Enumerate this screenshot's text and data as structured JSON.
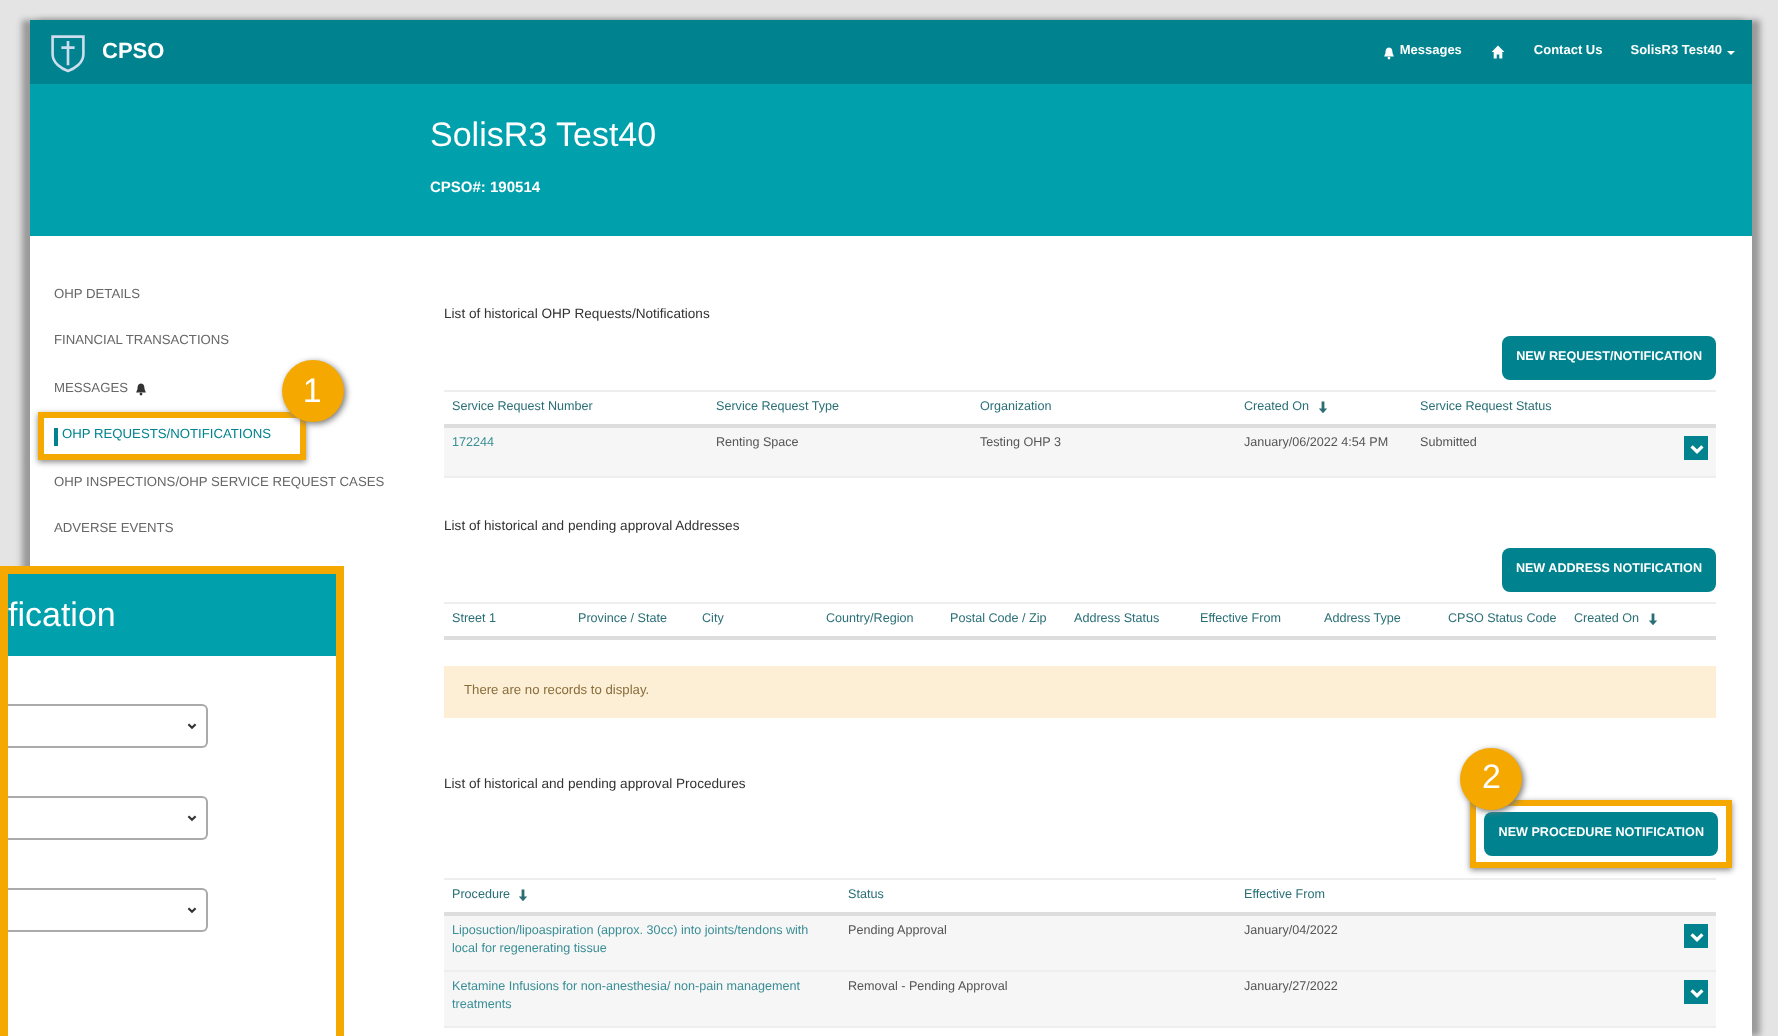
{
  "navbar": {
    "brand": "CPSO",
    "links": [
      {
        "kind": "messages",
        "label": "Messages"
      },
      {
        "kind": "home"
      },
      {
        "kind": "text",
        "label": "Contact Us"
      },
      {
        "kind": "user",
        "label": "SolisR3 Test40"
      }
    ]
  },
  "header": {
    "name": "SolisR3 Test40",
    "cpso_number": "CPSO#: 190514"
  },
  "sidebar": {
    "items": [
      {
        "label": "OHP DETAILS",
        "selected": false,
        "bell": false
      },
      {
        "label": "FINANCIAL TRANSACTIONS",
        "selected": false,
        "bell": false
      },
      {
        "label": "MESSAGES",
        "selected": false,
        "bell": true
      },
      {
        "label": "OHP REQUESTS/NOTIFICATIONS",
        "selected": true,
        "bell": false,
        "callout": "1"
      },
      {
        "label": "OHP INSPECTIONS/OHP SERVICE REQUEST CASES",
        "selected": false,
        "bell": false
      },
      {
        "label": "ADVERSE EVENTS",
        "selected": false,
        "bell": false
      }
    ]
  },
  "sections": [
    {
      "title": "List of historical OHP Requests/Notifications",
      "button": {
        "label": "NEW REQUEST/NOTIFICATION"
      },
      "columns": [
        {
          "label": "Service Request Number",
          "sorted": false
        },
        {
          "label": "Service Request Type",
          "sorted": false
        },
        {
          "label": "Organization",
          "sorted": false
        },
        {
          "label": "Created On",
          "sorted": true
        },
        {
          "label": "Service Request Status",
          "sorted": false
        }
      ],
      "rows": [
        {
          "cells": [
            "172244",
            "Renting Space",
            "Testing OHP 3",
            "January/06/2022 4:54 PM",
            "Submitted"
          ]
        }
      ]
    },
    {
      "title": "List of historical and pending approval Addresses",
      "button": {
        "label": "NEW ADDRESS NOTIFICATION"
      },
      "columns": [
        {
          "label": "Street 1",
          "sorted": false
        },
        {
          "label": "Province / State",
          "sorted": false
        },
        {
          "label": "City",
          "sorted": false
        },
        {
          "label": "Country/Region",
          "sorted": false
        },
        {
          "label": "Postal Code / Zip",
          "sorted": false
        },
        {
          "label": "Address Status",
          "sorted": false
        },
        {
          "label": "Effective From",
          "sorted": false
        },
        {
          "label": "Address Type",
          "sorted": false
        },
        {
          "label": "CPSO Status Code",
          "sorted": false
        },
        {
          "label": "Created On",
          "sorted": true
        }
      ],
      "empty_message": "There are no records to display."
    },
    {
      "title": "List of historical and pending approval Procedures",
      "button": {
        "label": "NEW PROCEDURE NOTIFICATION",
        "callout": "2"
      },
      "columns": [
        {
          "label": "Procedure",
          "sorted": true
        },
        {
          "label": "Status",
          "sorted": false
        },
        {
          "label": "Effective From",
          "sorted": false
        }
      ],
      "rows": [
        {
          "cells": [
            "Liposuction/lipoaspiration (approx. 30cc) into joints/tendons with local for regenerating tissue",
            "Pending Approval",
            "January/04/2022"
          ]
        },
        {
          "cells": [
            "Ketamine Infusions for non-anesthesia/ non-pain management treatments",
            "Removal - Pending Approval",
            "January/27/2022"
          ]
        }
      ]
    }
  ],
  "overlay_panel": {
    "title": "fication",
    "fields": [
      {
        "kind": "select"
      },
      {
        "kind": "select"
      },
      {
        "kind": "select"
      }
    ]
  }
}
